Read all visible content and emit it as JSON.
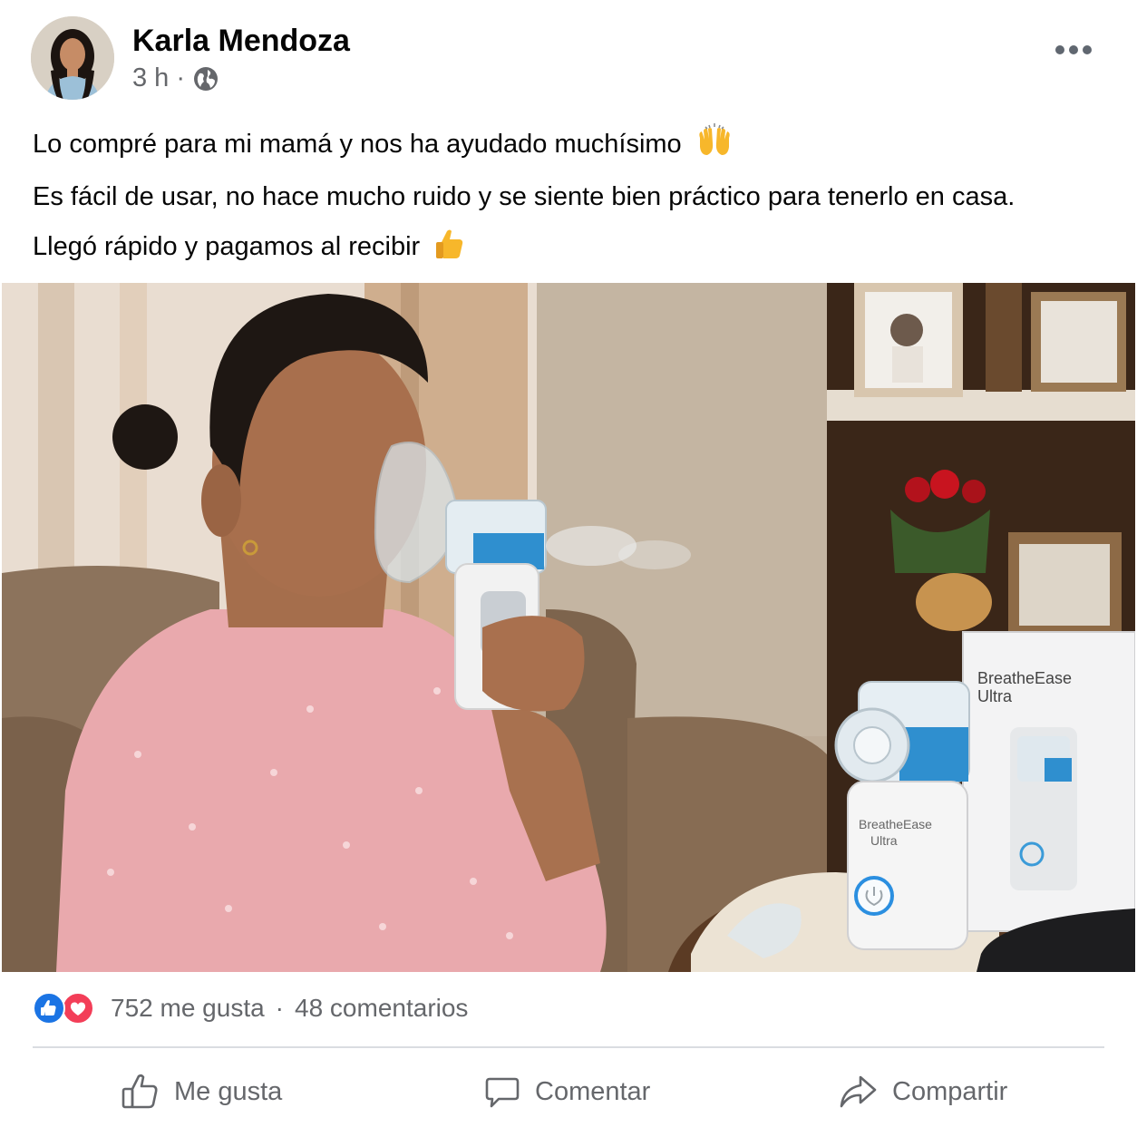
{
  "post": {
    "author": "Karla Mendoza",
    "time": "3 h",
    "dot": "·",
    "privacy_icon": "globe-icon",
    "more_icon": "more-options-icon",
    "text_line_1": "Lo compré para mi mamá y nos ha ayudado muchísimo",
    "text_line_2": "Es fácil de usar, no hace mucho ruido y se siente bien práctico para tenerlo en casa.",
    "text_line_3": "Llegó rápido y pagamos al recibir",
    "emoji_1": "raising-hands-icon",
    "emoji_2": "thumbs-up-icon"
  },
  "photo": {
    "box_brand": "BreatheEase",
    "box_model": "Ultra",
    "device_brand": "BreatheEase",
    "device_model": "Ultra"
  },
  "stats": {
    "likes": "752 me gusta",
    "separator": "·",
    "comments": "48 comentarios"
  },
  "actions": {
    "like": "Me gusta",
    "comment": "Comentar",
    "share": "Compartir"
  },
  "colors": {
    "like_blue": "#1b74e4",
    "love_red": "#f33e58",
    "secondary_text": "#65676b",
    "divider": "#dadde1"
  }
}
